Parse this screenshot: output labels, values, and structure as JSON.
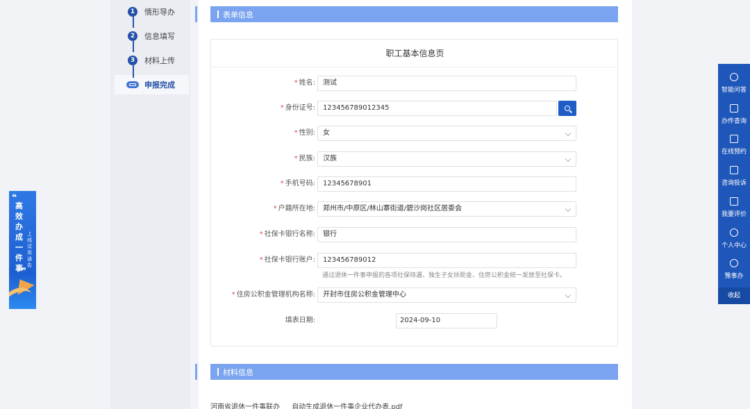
{
  "steps": [
    {
      "num": "1",
      "label": "情形导办"
    },
    {
      "num": "2",
      "label": "信息填写"
    },
    {
      "num": "3",
      "label": "材料上传"
    },
    {
      "label": "申报完成"
    }
  ],
  "sections": {
    "form_info": "表单信息",
    "materials": "材料信息"
  },
  "form": {
    "title": "职工基本信息页",
    "fields": {
      "name": {
        "label": "姓名:",
        "value": "测试"
      },
      "id_number": {
        "label": "身份证号:",
        "value": "123456789012345"
      },
      "gender": {
        "label": "性别:",
        "value": "女"
      },
      "ethnicity": {
        "label": "民族:",
        "value": "汉族"
      },
      "phone": {
        "label": "手机号码:",
        "value": "12345678901"
      },
      "household": {
        "label": "户籍所在地:",
        "value": "郑州市/中原区/林山寨街道/碧沙岗社区居委会"
      },
      "bank_name": {
        "label": "社保卡银行名称:",
        "value": "银行"
      },
      "bank_account": {
        "label": "社保卡银行账户:",
        "value": "123456789012",
        "hint": "通过退休一件事申报的各项社保待遇、独生子女扶助金、住房公积金统一发放至社保卡。"
      },
      "fund_center": {
        "label": "住房公积金管理机构名称:",
        "value": "开封市住房公积金管理中心"
      },
      "fill_date": {
        "label": "填表日期:",
        "value": "2024-09-10"
      }
    }
  },
  "materials": {
    "left_text": "河南省退休一件事联办",
    "file_name": "自动生成退休一件事企业代办表.pdf"
  },
  "banner": {
    "quote_open": "❝",
    "headline": "高效办成一件事",
    "subline": "上线试用通告",
    "quote_close": "❞"
  },
  "rightbar": {
    "items": [
      "智能问答",
      "办件查询",
      "在线预约",
      "咨询投诉",
      "我要评价",
      "个人中心",
      "豫事办"
    ],
    "collapse": "收起"
  }
}
